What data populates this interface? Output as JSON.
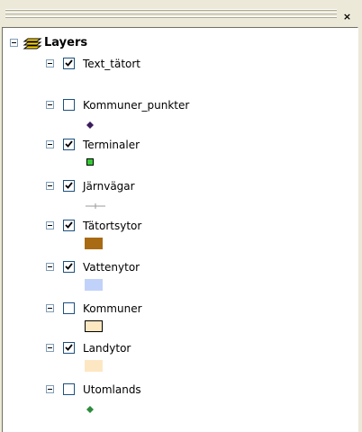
{
  "panel": {
    "close_glyph": "×"
  },
  "root": {
    "label": "Layers",
    "icon": "layers-icon"
  },
  "layers": [
    {
      "name": "Text_tätort",
      "checked": true,
      "symbol": "none"
    },
    {
      "name": "Kommuner_punkter",
      "checked": false,
      "symbol": "point",
      "color": "#3b1a5e"
    },
    {
      "name": "Terminaler",
      "checked": true,
      "symbol": "square-point",
      "color": "#33cc33"
    },
    {
      "name": "Järnvägar",
      "checked": true,
      "symbol": "line",
      "color": "#9a9a9a"
    },
    {
      "name": "Tätortsytor",
      "checked": true,
      "symbol": "polygon",
      "color": "#a86a13"
    },
    {
      "name": "Vattenytor",
      "checked": true,
      "symbol": "polygon",
      "color": "#c1d2fa"
    },
    {
      "name": "Kommuner",
      "checked": false,
      "symbol": "polygon-outline",
      "color": "#fde7c1"
    },
    {
      "name": "Landytor",
      "checked": true,
      "symbol": "polygon",
      "color": "#fde7c3"
    },
    {
      "name": "Utomlands",
      "checked": false,
      "symbol": "point",
      "color": "#2e8b3e"
    }
  ]
}
